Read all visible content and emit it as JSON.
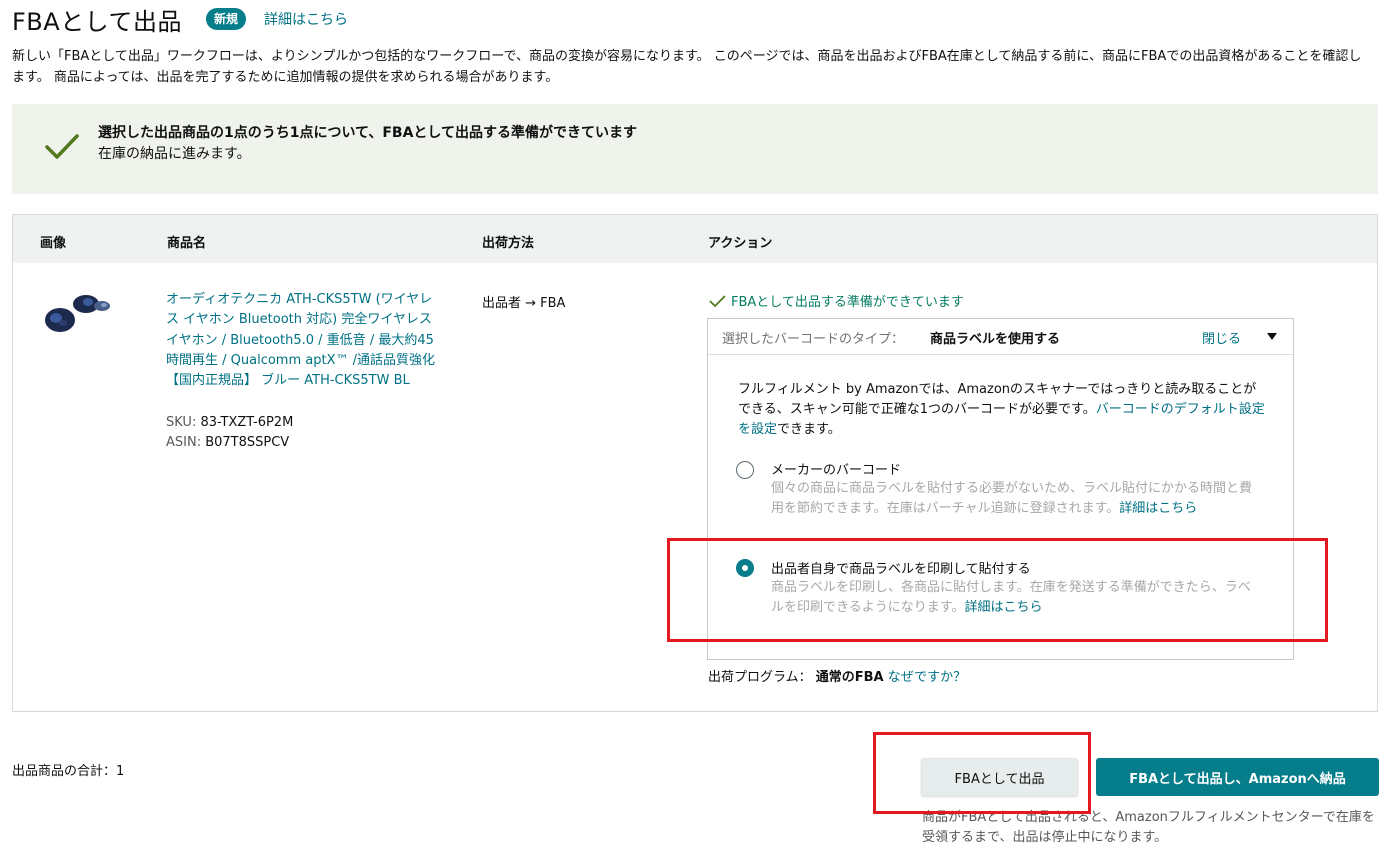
{
  "header": {
    "title": "FBAとして出品",
    "badge": "新規",
    "details_link": "詳細はこちら",
    "intro": "新しい「FBAとして出品」ワークフローは、よりシンプルかつ包括的なワークフローで、商品の変換が容易になります。 このページでは、商品を出品およびFBA在庫として納品する前に、商品にFBAでの出品資格があることを確認します。 商品によっては、出品を完了するために追加情報の提供を求められる場合があります。"
  },
  "success": {
    "title": "選択した出品商品の1点のうち1点について、FBAとして出品する準備ができています",
    "subtitle": "在庫の納品に進みます。"
  },
  "table": {
    "headers": {
      "image": "画像",
      "name": "商品名",
      "shipping": "出荷方法",
      "action": "アクション"
    },
    "row": {
      "product_name": "オーディオテクニカ ATH-CKS5TW (ワイヤレス イヤホン Bluetooth 対応) 完全ワイヤレスイヤホン / Bluetooth5.0 / 重低音 / 最大約45時間再生 / Qualcomm aptX™ /通話品質強化 【国内正規品】 ブルー ATH-CKS5TW BL",
      "sku_label": "SKU: ",
      "sku": "83-TXZT-6P2M",
      "asin_label": "ASIN: ",
      "asin": "B07T8SSPCV",
      "shipping_method": "出品者 → FBA",
      "ready_text": "FBAとして出品する準備ができています"
    }
  },
  "barcode": {
    "type_label": "選択したバーコードのタイプ：",
    "type_value": "商品ラベルを使用する",
    "close": "閉じる",
    "intro_text": "フルフィルメント by Amazonでは、Amazonのスキャナーではっきりと読み取ることができる、スキャン可能で正確な1つのバーコードが必要です。",
    "default_link": "バーコードのデフォルト設定を設定",
    "intro_tail": "できます。",
    "options": [
      {
        "title": "メーカーのバーコード",
        "desc": "個々の商品に商品ラベルを貼付する必要がないため、ラベル貼付にかかる時間と費用を節約できます。在庫はバーチャル追跡に登録されます。",
        "link": "詳細はこちら",
        "selected": false
      },
      {
        "title": "出品者自身で商品ラベルを印刷して貼付する",
        "desc": "商品ラベルを印刷し、各商品に貼付します。在庫を発送する準備ができたら、ラベルを印刷できるようになります。",
        "link": "詳細はこちら",
        "selected": true
      }
    ]
  },
  "program": {
    "label": "出荷プログラム：",
    "value": "通常のFBA",
    "why_link": "なぜですか？"
  },
  "footer": {
    "total": "出品商品の合計：1",
    "list_button": "FBAとして出品",
    "list_send_button": "FBAとして出品し、Amazonへ納品",
    "note": "商品がFBAとして出品されると、Amazonフルフィルメントセンターで在庫を受領するまで、出品は停止中になります。"
  },
  "colors": {
    "accent": "#067d8a",
    "success": "#067d62",
    "highlight": "#e31922"
  }
}
